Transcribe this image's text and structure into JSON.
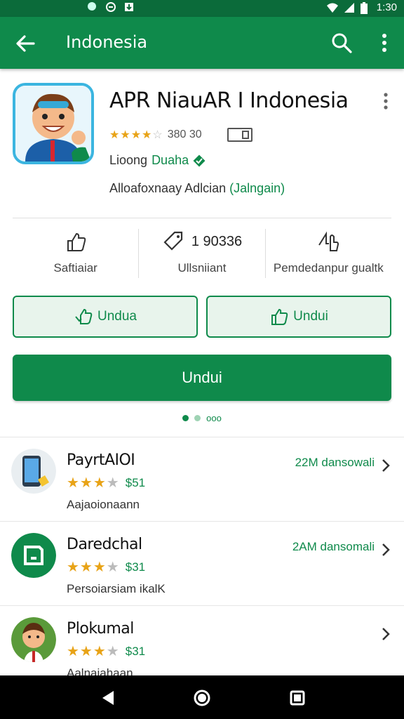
{
  "status_bar": {
    "time": "1:30"
  },
  "toolbar": {
    "title": "Indonesia"
  },
  "app": {
    "name": "APR NiauAR I Indonesia",
    "rating_stars": 4.5,
    "rating_count": "380 30",
    "developer_prefix": "Lioong",
    "developer_name": "Duaha",
    "category_text": "Alloafoxnaay Adlcian",
    "category_highlight": "(Jalngain)"
  },
  "stats": [
    {
      "value": "",
      "label": "Saftiaiar",
      "icon": "thumbs-up-icon"
    },
    {
      "value": "1 90336",
      "label": "Ullsniiant",
      "icon": "tag-icon"
    },
    {
      "value": "",
      "label": "Pemdedanpur gualtk",
      "icon": "rating-hand-icon"
    }
  ],
  "buttons": {
    "install_left": "Undua",
    "install_right": "Undui",
    "primary": "Undui"
  },
  "pager": {
    "label": "ooo"
  },
  "list": [
    {
      "name": "PayrtAIOI",
      "rating_stars": 3,
      "price": "$51",
      "subtitle": "Aajaoionaann",
      "size": "22M dansowali",
      "icon": "phone-app-icon"
    },
    {
      "name": "Daredchal",
      "rating_stars": 3,
      "price": "$31",
      "subtitle": "Persoiarsiam ikalK",
      "size": "2AM dansomali",
      "icon": "green-circle-app-icon"
    },
    {
      "name": "Plokumal",
      "rating_stars": 3,
      "price": "$31",
      "subtitle": "Aalnaiahaan",
      "size": "",
      "icon": "character-app-icon"
    }
  ],
  "colors": {
    "primary": "#0f8a4b",
    "status_bar": "#0b6b3a",
    "star": "#e8a317"
  }
}
